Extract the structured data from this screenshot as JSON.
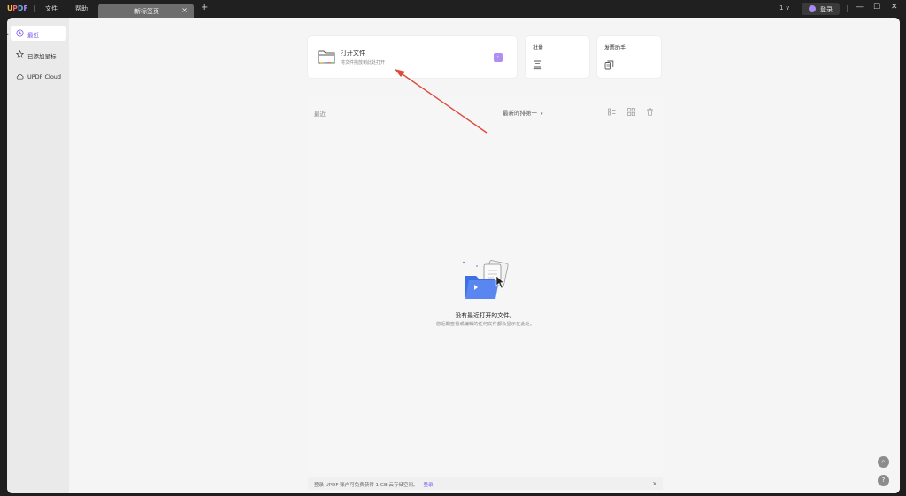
{
  "titlebar": {
    "logo": {
      "u": "U",
      "p": "P",
      "d": "D",
      "f": "F"
    },
    "menu_file": "文件",
    "menu_help": "帮助",
    "tab_label": "新标签页",
    "tab_close": "×",
    "tab_add": "+",
    "page_indicator": "1 ∨",
    "login_label": "登录",
    "minimize": "—",
    "maximize": "☐",
    "close": "✕"
  },
  "sidebar": {
    "collapse": "▸",
    "items": [
      {
        "label": "最近",
        "icon": "clock-icon"
      },
      {
        "label": "已添加星标",
        "icon": "star-icon"
      },
      {
        "label": "UPDF Cloud",
        "icon": "cloud-icon"
      }
    ]
  },
  "cards": {
    "open_file": {
      "title": "打开文件",
      "subtitle": "将文件拖放到此处打开",
      "chip": "›"
    },
    "batch": {
      "title": "批量"
    },
    "ai": {
      "title": "发票助手"
    }
  },
  "recent": {
    "header": "最近",
    "sort_label": "最新的排第一",
    "sort_caret": "▾",
    "empty_title": "没有最近打开的文件。",
    "empty_subtitle": "您近期查看或编辑的任何文件都会显示在此处。"
  },
  "footer": {
    "message": "登录 UPDF 账户可免费获得 1 GB 云存储空间。",
    "link": "登录",
    "close": "×"
  },
  "fabs": {
    "search": "⌕",
    "help": "?"
  },
  "colors": {
    "accent": "#7a57ea",
    "arrow": "#e04a3a",
    "titlebar": "#202020"
  }
}
